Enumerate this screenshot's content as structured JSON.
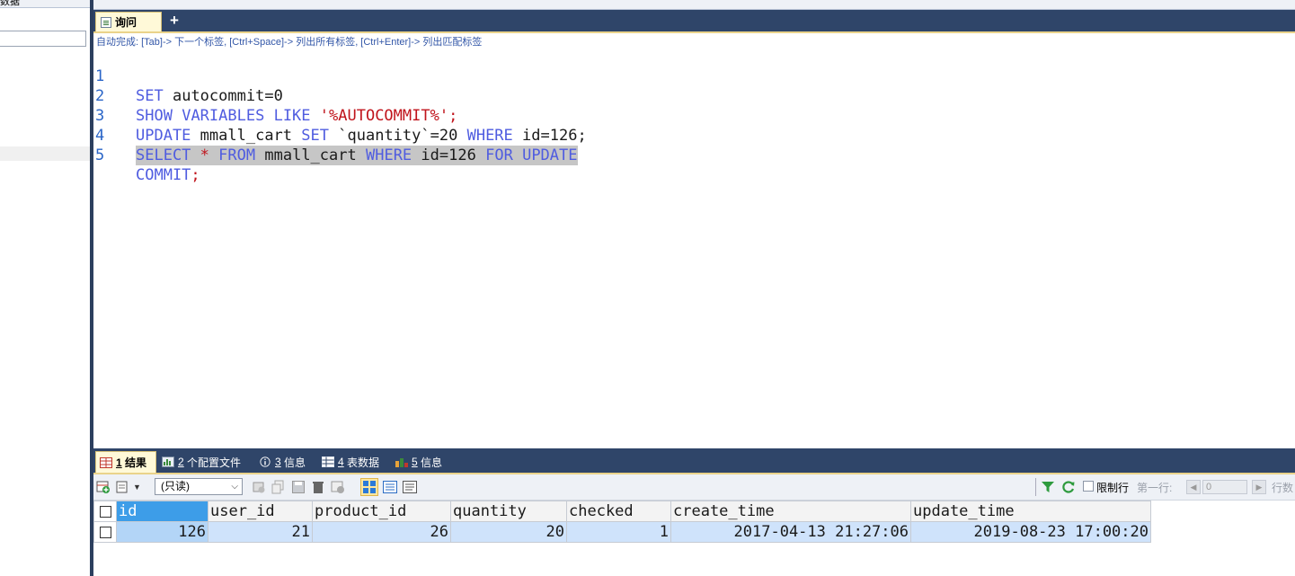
{
  "left_panel": {
    "top_text": "数据"
  },
  "editor": {
    "tabs": [
      {
        "label": "询问"
      }
    ],
    "add_tab_label": "+",
    "hint": "自动完成: [Tab]-> 下一个标签, [Ctrl+Space]-> 列出所有标签, [Ctrl+Enter]-> 列出匹配标签",
    "line_numbers": [
      "1",
      "2",
      "3",
      "4",
      "5"
    ],
    "lines": [
      "SET autocommit=0",
      "SHOW VARIABLES LIKE '%AUTOCOMMIT%';",
      "UPDATE mmall_cart SET `quantity`=20 WHERE id=126;",
      "SELECT * FROM mmall_cart WHERE id=126 FOR UPDATE",
      "COMMIT;"
    ],
    "highlighted_line": 4
  },
  "results": {
    "tabs": [
      {
        "num": "1",
        "label": "结果",
        "icon": "grid-result-icon",
        "active": true
      },
      {
        "num": "2",
        "label": "个配置文件",
        "icon": "profile-icon"
      },
      {
        "num": "3",
        "label": "信息",
        "icon": "info-icon"
      },
      {
        "num": "4",
        "label": "表数据",
        "icon": "table-data-icon"
      },
      {
        "num": "5",
        "label": "信息",
        "icon": "message-icon"
      }
    ],
    "toolbar": {
      "mode_value": "(只读)",
      "limit_rows_label": "限制行",
      "first_row_label": "第一行:",
      "first_row_value": "0",
      "rows_label": "行数"
    },
    "grid": {
      "columns": [
        "id",
        "user_id",
        "product_id",
        "quantity",
        "checked",
        "create_time",
        "update_time"
      ],
      "rows": [
        [
          "126",
          "21",
          "26",
          "20",
          "1",
          "2017-04-13 21:27:06",
          "2019-08-23 17:00:20"
        ]
      ]
    }
  },
  "colors": {
    "keyword": "#4f5ce0",
    "string": "#c0141c",
    "tabbar": "#2f4569",
    "active_tab": "#fff9d8",
    "selected_header": "#3d9de8",
    "row_background": "#cfe3fb"
  }
}
